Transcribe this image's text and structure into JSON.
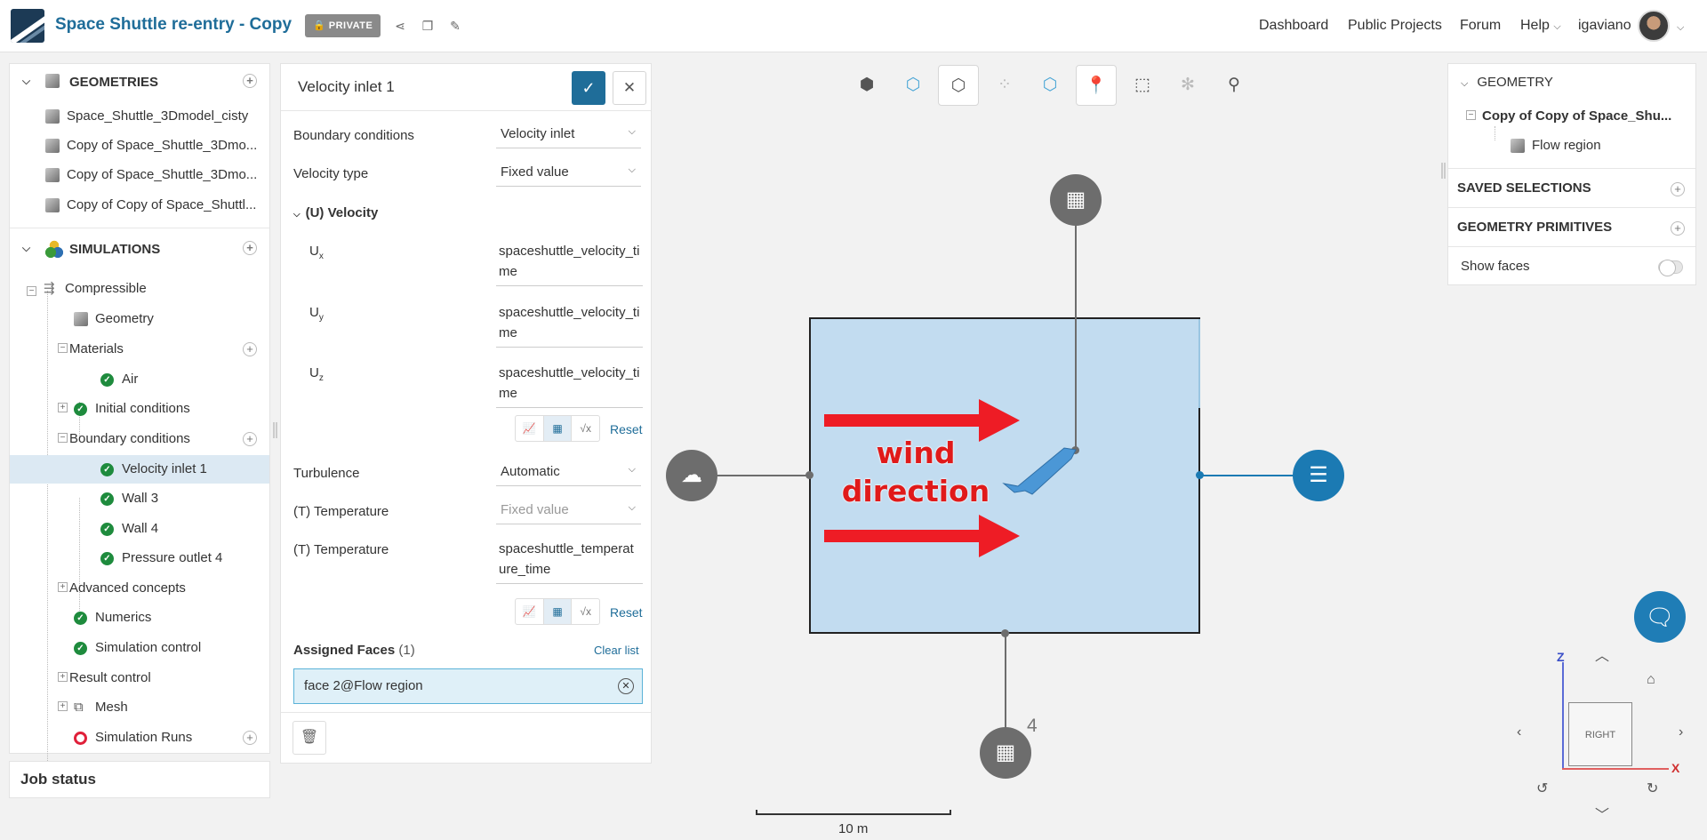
{
  "header": {
    "project_title": "Space Shuttle re-entry - Copy",
    "visibility_badge": "PRIVATE",
    "nav": [
      "Dashboard",
      "Public Projects",
      "Forum",
      "Help"
    ],
    "username": "igaviano"
  },
  "left_panel": {
    "geometries": {
      "title": "GEOMETRIES",
      "items": [
        "Space_Shuttle_3Dmodel_cisty",
        "Copy of Space_Shuttle_3Dmo...",
        "Copy of Space_Shuttle_3Dmo...",
        "Copy of Copy of Space_Shuttl..."
      ]
    },
    "simulations": {
      "title": "SIMULATIONS",
      "root": "Compressible",
      "geometry": "Geometry",
      "materials": "Materials",
      "air": "Air",
      "initial_conditions": "Initial conditions",
      "boundary_conditions": "Boundary conditions",
      "bc_items": [
        "Velocity inlet 1",
        "Wall 3",
        "Wall 4",
        "Pressure outlet 4"
      ],
      "advanced_concepts": "Advanced concepts",
      "numerics": "Numerics",
      "simulation_control": "Simulation control",
      "result_control": "Result control",
      "mesh": "Mesh",
      "simulation_runs": "Simulation Runs"
    },
    "job_status": "Job status"
  },
  "editor": {
    "title": "Velocity inlet 1",
    "boundary_conditions_label": "Boundary conditions",
    "boundary_conditions_value": "Velocity inlet",
    "velocity_type_label": "Velocity type",
    "velocity_type_value": "Fixed value",
    "velocity_section": "(U) Velocity",
    "ux_value": "spaceshuttle_velocity_time",
    "uy_value": "spaceshuttle_velocity_time",
    "uz_value": "spaceshuttle_velocity_time",
    "reset": "Reset",
    "turbulence_label": "Turbulence",
    "turbulence_value": "Automatic",
    "temperature_label": "(T) Temperature",
    "temperature_type_value": "Fixed value",
    "temperature_label2": "(T) Temperature",
    "temperature_value": "spaceshuttle_temperature_time",
    "assigned_faces_label": "Assigned Faces",
    "assigned_faces_count": "(1)",
    "clear_list": "Clear list",
    "face": "face 2@Flow region"
  },
  "viewport": {
    "annotation_line1": "wind",
    "annotation_line2": "direction",
    "node_label_4": "4",
    "scale_label": "10 m",
    "orientation_face": "RIGHT",
    "axis_z": "Z",
    "axis_x": "X"
  },
  "right_panel": {
    "geometry_title": "GEOMETRY",
    "geometry_root": "Copy of Copy of Space_Shu...",
    "flow_region": "Flow region",
    "saved_selections": "SAVED SELECTIONS",
    "geometry_primitives": "GEOMETRY PRIMITIVES",
    "show_faces": "Show faces"
  },
  "colors": {
    "brand": "#1f6d99",
    "domain_fill": "#c2dcf0",
    "annotation_red": "#ee1c25",
    "success": "#1e8b3d"
  }
}
